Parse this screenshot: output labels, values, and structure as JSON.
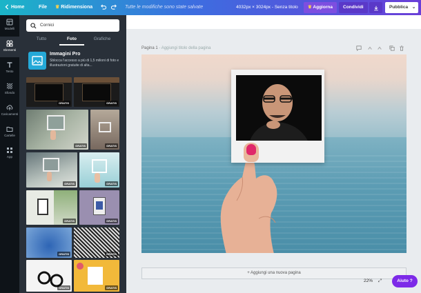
{
  "topbar": {
    "home": "Home",
    "file": "File",
    "resize": "Ridimensiona",
    "status": "Tutte le modifiche sono state salvate",
    "doc_info": "4032px × 3024px - Senza titolo",
    "upgrade": "Aggiorna",
    "share": "Condividi",
    "publish": "Pubblica"
  },
  "rail": {
    "items": [
      {
        "label": "Modelli",
        "icon": "template-icon"
      },
      {
        "label": "Elementi",
        "icon": "elements-icon"
      },
      {
        "label": "Testo",
        "icon": "text-icon"
      },
      {
        "label": "Sfondo",
        "icon": "background-icon"
      },
      {
        "label": "Caricamenti",
        "icon": "upload-icon"
      },
      {
        "label": "Cartelle",
        "icon": "folder-icon"
      },
      {
        "label": "App",
        "icon": "apps-icon"
      }
    ]
  },
  "panel": {
    "search_value": "Cornici",
    "tabs": [
      "Tutto",
      "Foto",
      "Grafiche"
    ],
    "promo_title": "Immagini Pro",
    "promo_desc": "Sblocca l'accesso a più di 1,5 milioni di foto e illustrazioni gratuite di alta...",
    "badge": "GRATIS"
  },
  "canvas": {
    "page_label": "Pagina 1",
    "page_title_placeholder": "Aggiungi titolo della pagina",
    "add_page": "+ Aggiungi una nuova pagina",
    "zoom": "22%",
    "help": "Aiuto ?"
  },
  "colors": {
    "accent": "#7d2ae8",
    "panel": "#293039",
    "rail": "#0e1318"
  }
}
